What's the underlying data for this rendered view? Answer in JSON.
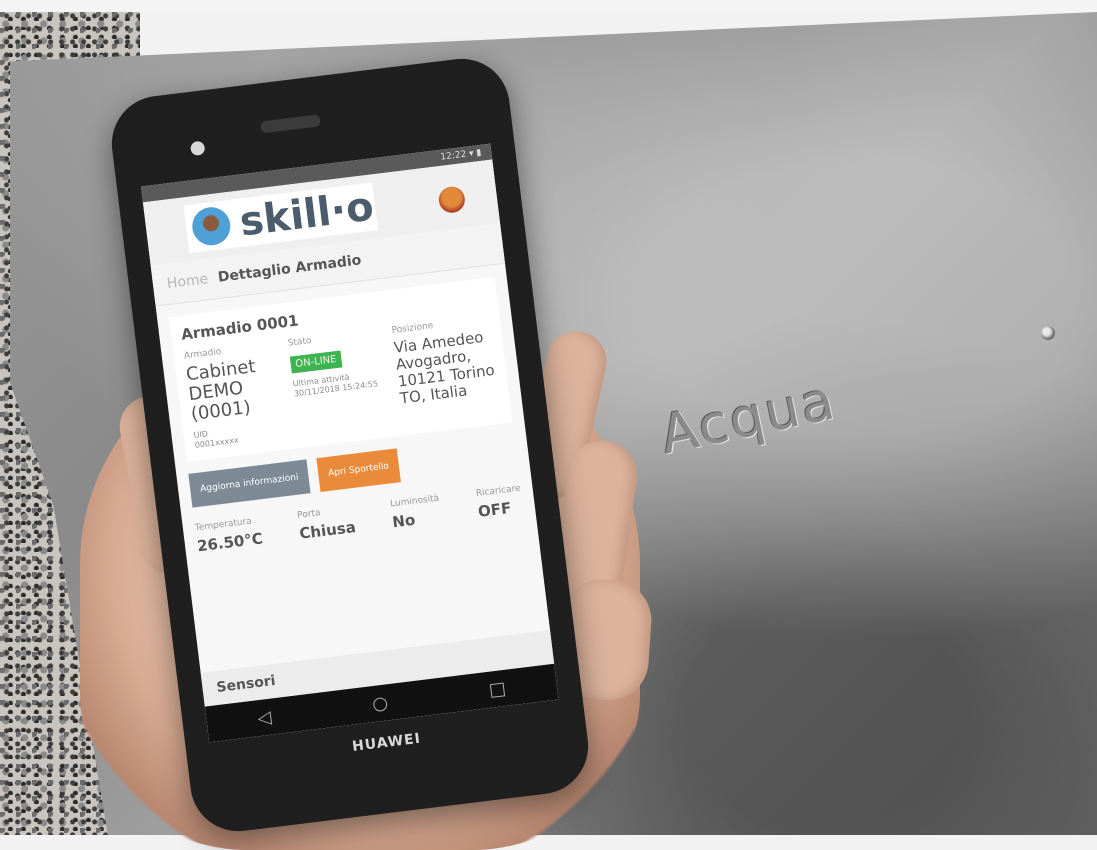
{
  "photo": {
    "embossed_text": "Acqua"
  },
  "phone": {
    "brand": "HUAWEI",
    "status_bar": "12:22 ▾ ▮",
    "app": {
      "logo_text": "skill·o",
      "breadcrumb": {
        "home": "Home",
        "current": "Dettaglio Armadio"
      },
      "card": {
        "title": "Armadio 0001",
        "armadio_label": "Armadio",
        "armadio_value": "Cabinet DEMO (0001)",
        "uid_label": "UID",
        "uid_value": "0001xxxxx",
        "stato_label": "Stato",
        "stato_badge": "ON-LINE",
        "ultimo_label": "Ultima attività",
        "ultimo_value": "30/11/2018 15:24:55",
        "posizione_label": "Posizione",
        "posizione_value": "Via Amedeo Avogadro, 10121 Torino TO, Italia"
      },
      "buttons": {
        "refresh": "Aggiorna informazioni",
        "open_door": "Apri Sportello"
      },
      "sensors": [
        {
          "label": "Temperatura",
          "value": "26.50°C"
        },
        {
          "label": "Porta",
          "value": "Chiusa"
        },
        {
          "label": "Luminosità",
          "value": "No"
        },
        {
          "label": "Ricaricare",
          "value": "OFF"
        }
      ],
      "sensors_header": "Sensori"
    }
  }
}
